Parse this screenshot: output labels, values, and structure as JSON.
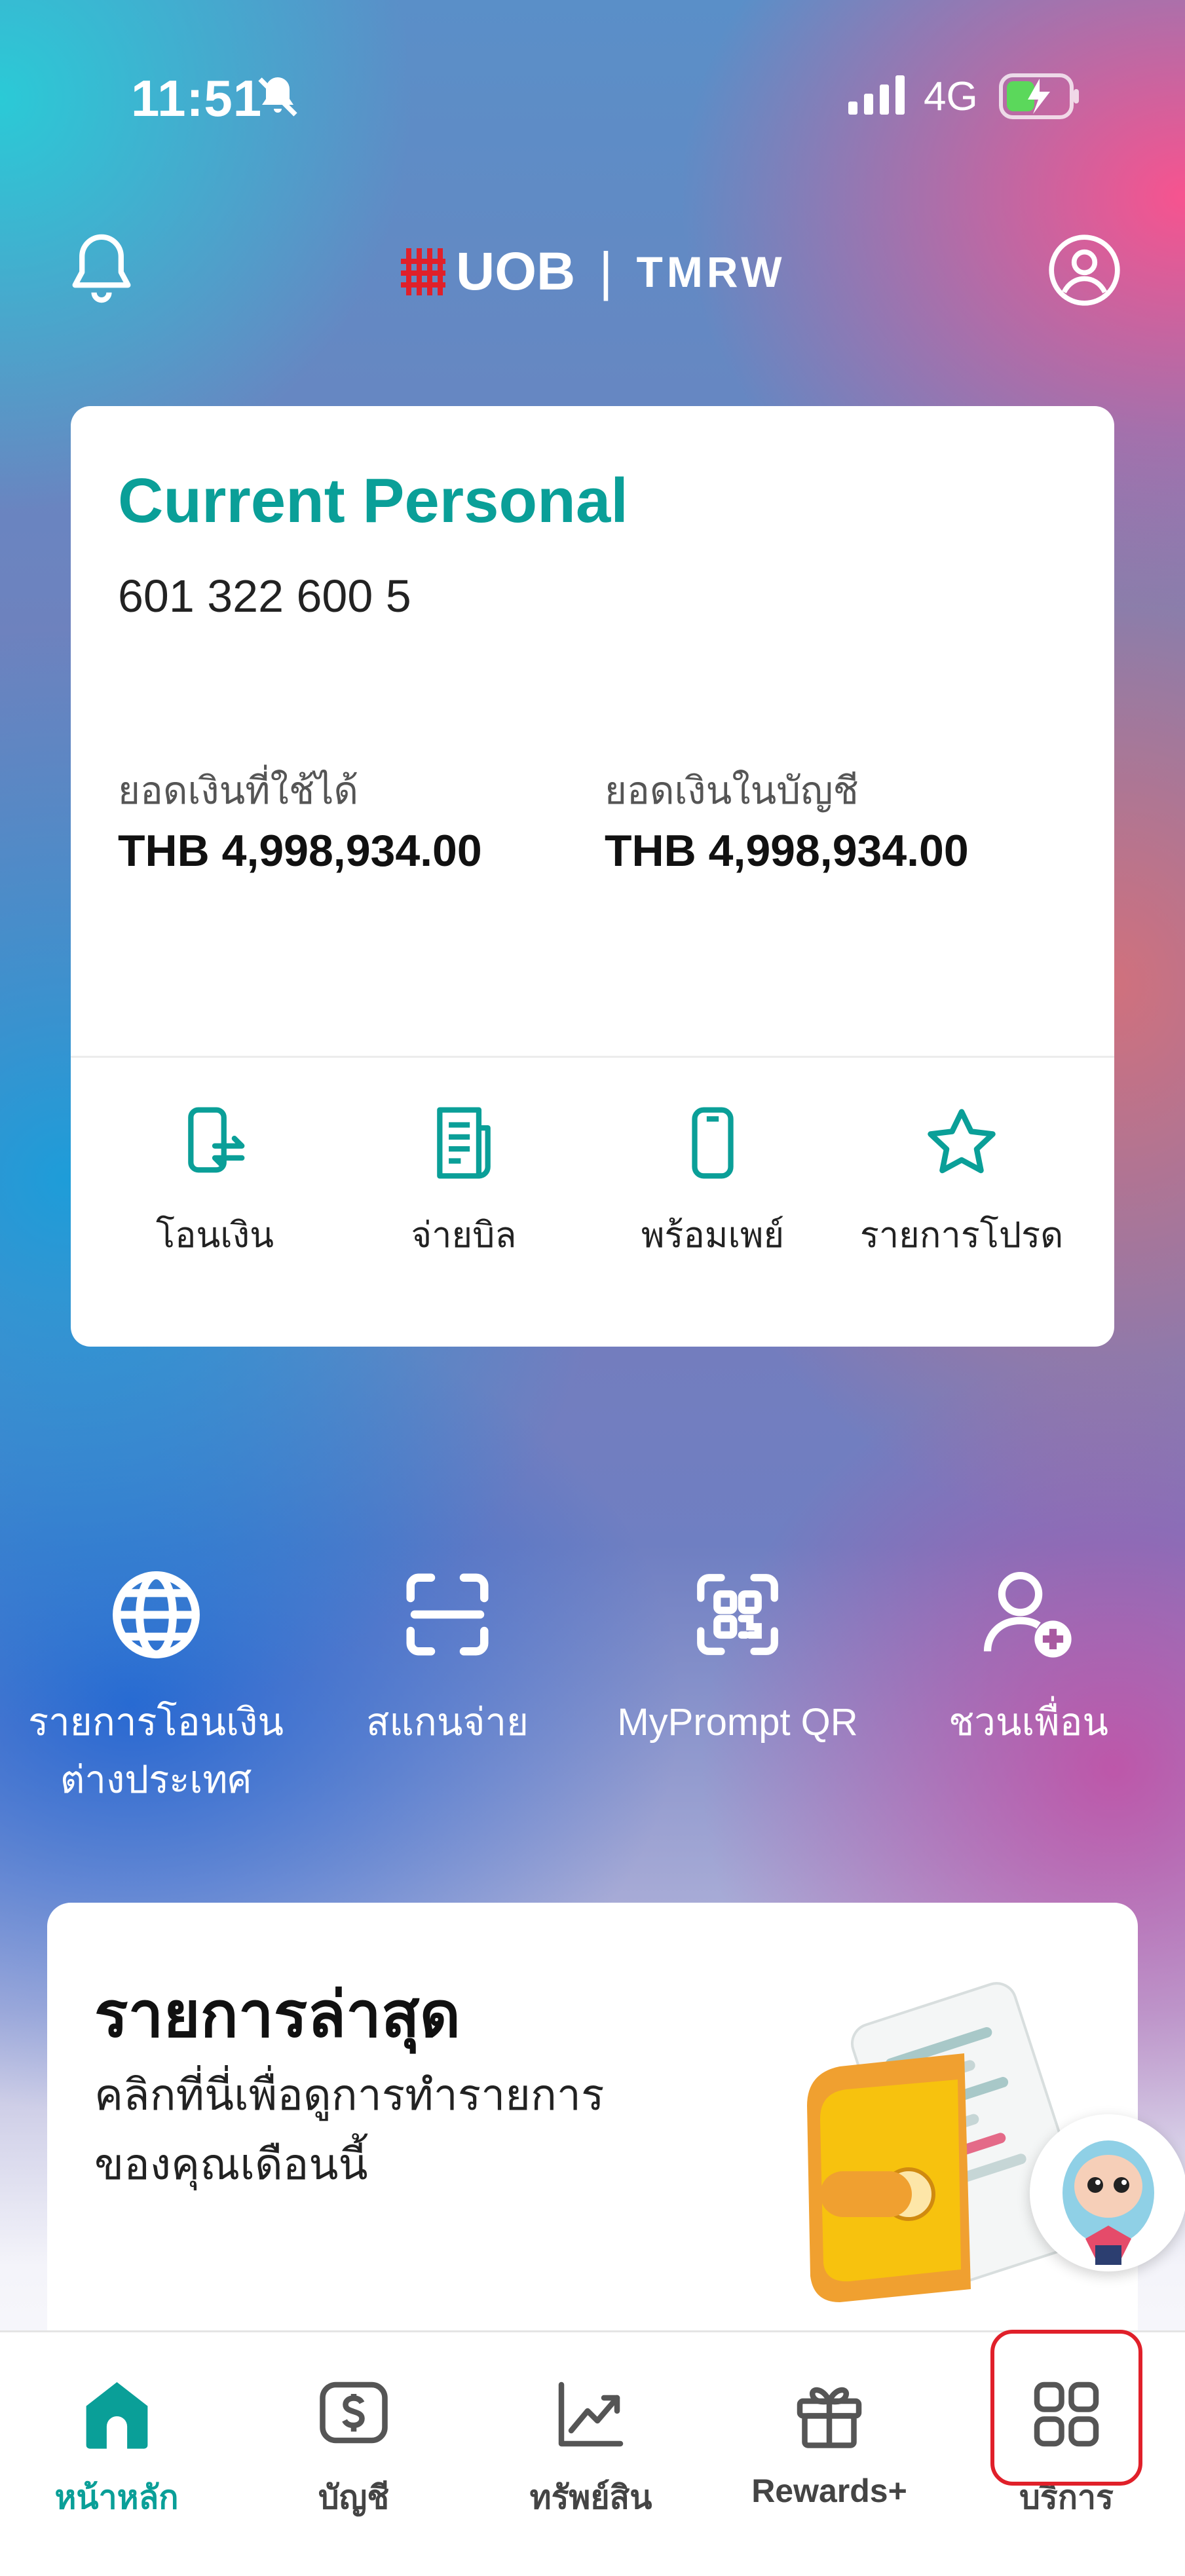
{
  "status_bar": {
    "time": "11:51",
    "network": "4G"
  },
  "header": {
    "brand_primary": "UOB",
    "brand_divider": "|",
    "brand_secondary": "TMRW"
  },
  "account_card": {
    "title": "Current Personal",
    "account_number": "601 322 600 5",
    "available_label": "ยอดเงินที่ใช้ได้",
    "available_value": "THB 4,998,934.00",
    "ledger_label": "ยอดเงินในบัญชี",
    "ledger_value": "THB 4,998,934.00",
    "actions": [
      {
        "label": "โอนเงิน",
        "icon": "phone-transfer-icon"
      },
      {
        "label": "จ่ายบิล",
        "icon": "bill-icon"
      },
      {
        "label": "พร้อมเพย์",
        "icon": "mobile-icon"
      },
      {
        "label": "รายการโปรด",
        "icon": "star-icon"
      }
    ]
  },
  "quick_actions": [
    {
      "label_line1": "รายการโอนเงิน",
      "label_line2": "ต่างประเทศ",
      "icon": "globe-icon"
    },
    {
      "label_line1": "สแกนจ่าย",
      "label_line2": "",
      "icon": "scan-icon"
    },
    {
      "label_line1": "MyPrompt QR",
      "label_line2": "",
      "icon": "qr-icon"
    },
    {
      "label_line1": "ชวนเพื่อน",
      "label_line2": "",
      "icon": "add-friend-icon"
    }
  ],
  "recent_card": {
    "title": "รายการล่าสุด",
    "subtitle_line1": "คลิกที่นี่เพื่อดูการทำรายการ",
    "subtitle_line2": "ของคุณเดือนนี้"
  },
  "bottom_nav": [
    {
      "label": "หน้าหลัก",
      "icon": "home-icon",
      "active": true
    },
    {
      "label": "บัญชี",
      "icon": "dollar-icon",
      "active": false
    },
    {
      "label": "ทรัพย์สิน",
      "icon": "chart-icon",
      "active": false
    },
    {
      "label": "Rewards+",
      "icon": "gift-icon",
      "active": false
    },
    {
      "label": "บริการ",
      "icon": "grid-icon",
      "active": false
    }
  ],
  "colors": {
    "accent": "#0a9f98",
    "brand_red": "#e0202a",
    "highlight": "#e0202a"
  }
}
